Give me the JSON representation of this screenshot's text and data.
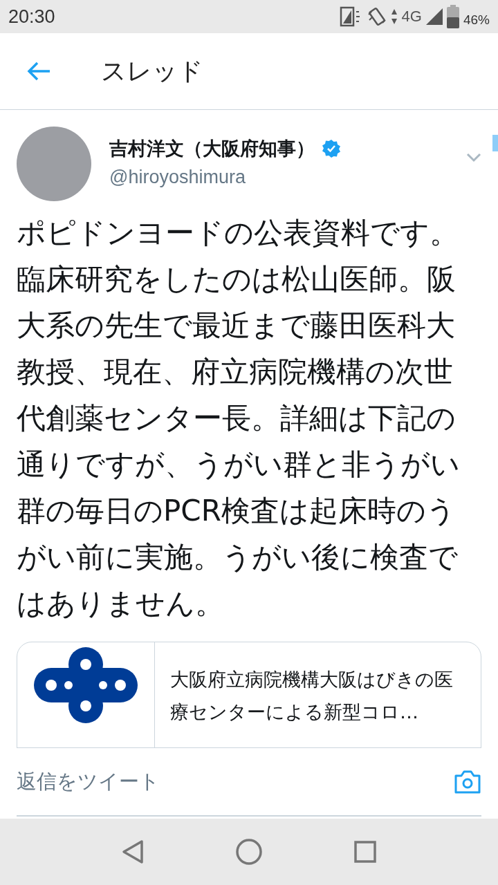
{
  "status_bar": {
    "time": "20:30",
    "network": "4G",
    "battery": "46%"
  },
  "header": {
    "title": "スレッド"
  },
  "tweet": {
    "name": "吉村洋文（大阪府知事）",
    "verified": true,
    "handle": "@hiroyoshimura",
    "text": "ポピドンヨードの公表資料です。臨床研究をしたのは松山医師。阪大系の先生で最近まで藤田医科大教授、現在、府立病院機構の次世代創薬センター長。詳細は下記の通りですが、うがい群と非うがい群の毎日のPCR検査は起床時のうがい前に実施。うがい後に検査ではありません。",
    "card": {
      "title": "大阪府立病院機構大阪はびきの医療センターによる新型コロ…"
    }
  },
  "reply_bar": {
    "placeholder": "返信をツイート"
  }
}
